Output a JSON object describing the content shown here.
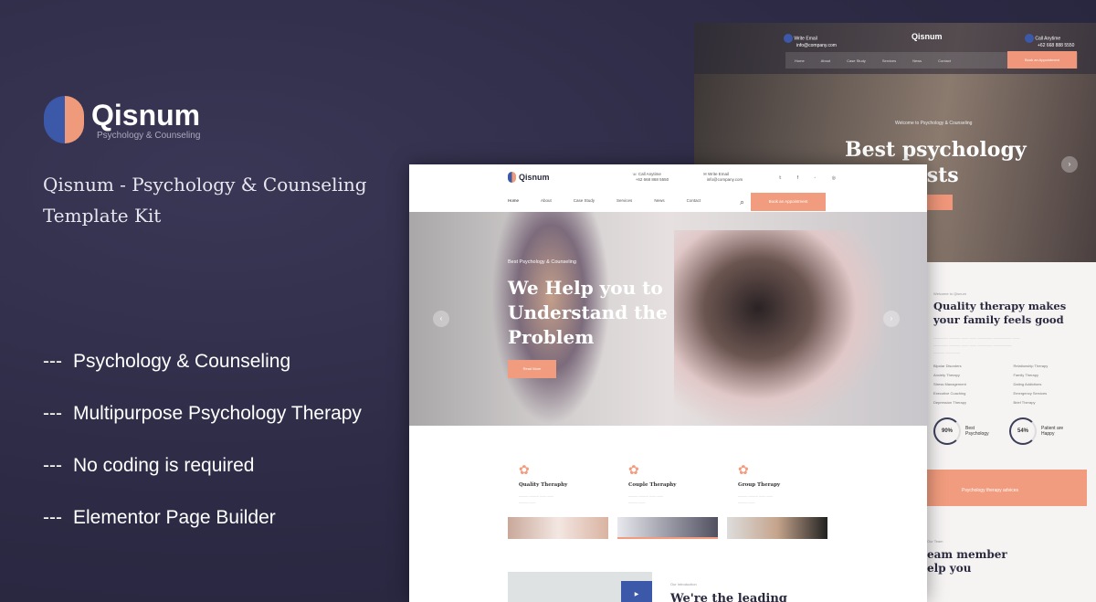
{
  "promo": {
    "brand": "Qisnum",
    "tagline": "Psychology & Counseling",
    "title": "Qisnum - Psychology & Counseling Template Kit",
    "features": [
      "Psychology & Counseling",
      "Multipurpose Psychology Therapy",
      "No coding is required",
      "Elementor Page Builder"
    ],
    "bullet_prefix": "---"
  },
  "colors": {
    "background": "#2c2a44",
    "accent": "#f19c7e",
    "brand_blue": "#3c58a8"
  },
  "back_mockup": {
    "logo": "Qisnum",
    "email_label": "Write Email",
    "email": "info@company.com",
    "phone_label": "Call Anytime",
    "phone": "+62 668 888 5550",
    "nav": [
      "Home",
      "About",
      "Case Study",
      "Services",
      "News",
      "Contact"
    ],
    "cta": "Book an Appointment",
    "hero_label": "Welcome to Psychology & Counseling",
    "hero_title": "Best psychology therapists",
    "section_label": "Welcome to Qisnum",
    "section_title": "Quality therapy makes your family feels good",
    "list": [
      "Bipolar Disorders",
      "Relationship Therapy",
      "Anxiety Therapy",
      "Family Therapy",
      "Stress Management",
      "Dating Addictions",
      "Executive Coaching",
      "Emergency Services",
      "Depression Therapy",
      "Brief Therapy"
    ],
    "stats": [
      {
        "value": "90%",
        "label": "Best Psychology",
        "fraction": 0.9
      },
      {
        "value": "54%",
        "label": "Patient are Happy",
        "fraction": 0.54
      }
    ],
    "advice": "Psychology therapy advices",
    "team_label": "Our Team",
    "team_title": "eam member elp you"
  },
  "front_mockup": {
    "logo": "Qisnum",
    "phone_label": "Call Anytime",
    "phone": "+62 668 868 5550",
    "email_label": "Write Email",
    "email": "info@company.com",
    "nav": [
      "Home",
      "About",
      "Case Study",
      "Services",
      "News",
      "Contact"
    ],
    "cta": "Book an Appointment",
    "hero_label": "Best Psychology & Counseling",
    "hero_title": "We Help you to Understand the Problem",
    "hero_button": "Read More",
    "cards": [
      {
        "title": "Quality Theraphy"
      },
      {
        "title": "Couple Theraphy"
      },
      {
        "title": "Group Therapy"
      }
    ],
    "advisory_label": "Our Introduction",
    "advisory_title": "We're the leading advisory center for you"
  }
}
